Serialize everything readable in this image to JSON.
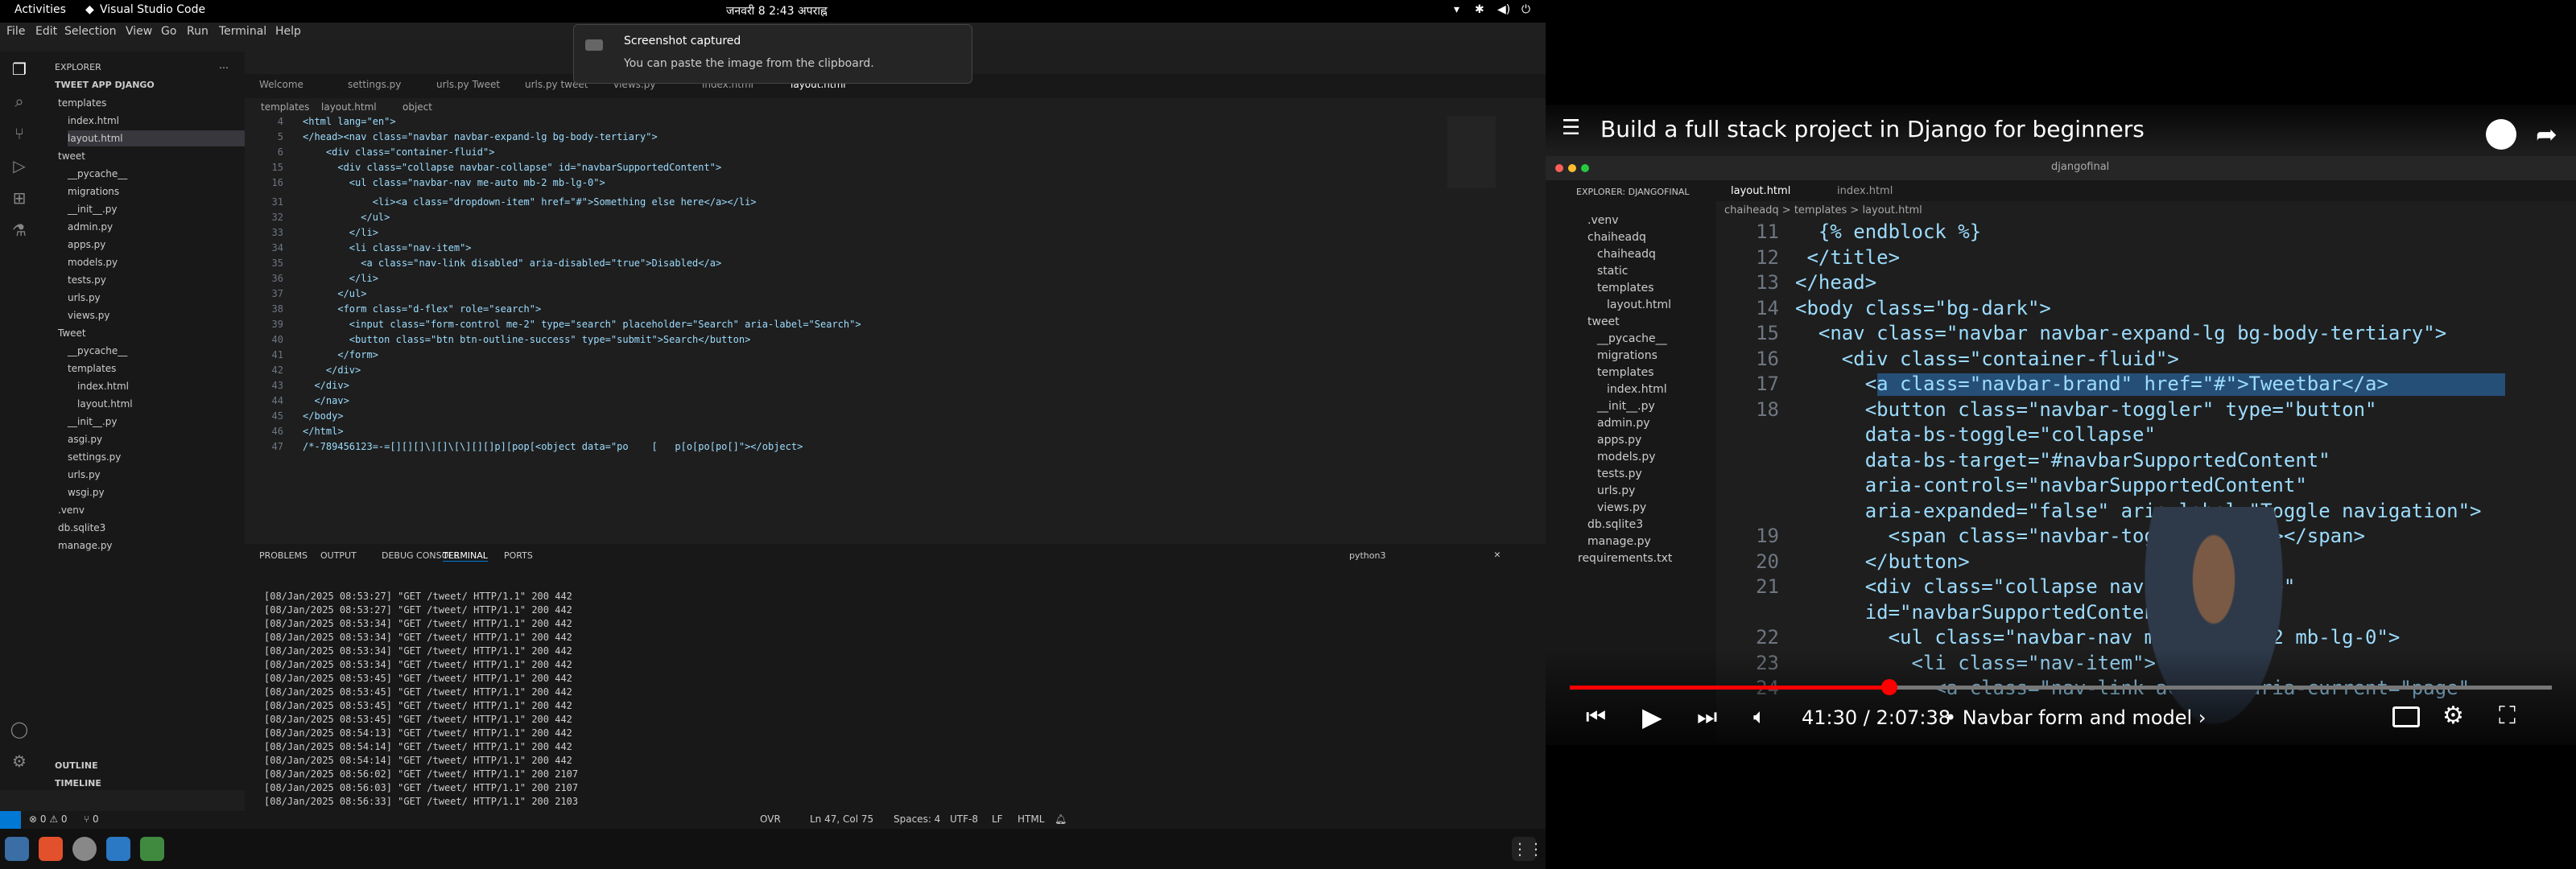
{
  "topbar": {
    "activities": "Activities",
    "app": "Visual Studio Code",
    "datetime": "जनवरी 8  2:43 अपराह्न"
  },
  "menu": [
    "File",
    "Edit",
    "Selection",
    "View",
    "Go",
    "Run",
    "Terminal",
    "Help"
  ],
  "notification": {
    "title": "Screenshot captured",
    "body": "You can paste the image from the clipboard."
  },
  "sidebar": {
    "header": "EXPLORER",
    "project": "TWEET APP DJANGO",
    "items": [
      "templates",
      "index.html",
      "layout.html",
      "tweet",
      "__pycache__",
      "migrations",
      "__init__.py",
      "admin.py",
      "apps.py",
      "models.py",
      "tests.py",
      "urls.py",
      "views.py",
      "Tweet",
      "__pycache__",
      "templates",
      "index.html",
      "layout.html",
      "__init__.py",
      "asgi.py",
      "settings.py",
      "urls.py",
      "wsgi.py",
      ".venv",
      "db.sqlite3",
      "manage.py"
    ],
    "outline": "OUTLINE",
    "timeline": "TIMELINE"
  },
  "tabs": [
    "Welcome",
    "settings.py",
    "urls.py Tweet",
    "urls.py tweet",
    "views.py",
    "index.html",
    "layout.html"
  ],
  "breadcrumb": [
    "templates",
    "layout.html",
    "object"
  ],
  "editor": {
    "sticky": [
      {
        "n": "4",
        "t": "<html lang=\"en\">"
      },
      {
        "n": "5",
        "t": "</head><nav class=\"navbar navbar-expand-lg bg-body-tertiary\">"
      },
      {
        "n": "6",
        "t": "    <div class=\"container-fluid\">"
      },
      {
        "n": "15",
        "t": "      <div class=\"collapse navbar-collapse\" id=\"navbarSupportedContent\">"
      },
      {
        "n": "16",
        "t": "        <ul class=\"navbar-nav me-auto mb-2 mb-lg-0\">"
      }
    ],
    "lines": [
      {
        "n": "31",
        "t": "            <li><a class=\"dropdown-item\" href=\"#\">Something else here</a></li>"
      },
      {
        "n": "32",
        "t": "          </ul>"
      },
      {
        "n": "33",
        "t": "        </li>"
      },
      {
        "n": "34",
        "t": "        <li class=\"nav-item\">"
      },
      {
        "n": "35",
        "t": "          <a class=\"nav-link disabled\" aria-disabled=\"true\">Disabled</a>"
      },
      {
        "n": "36",
        "t": "        </li>"
      },
      {
        "n": "37",
        "t": "      </ul>"
      },
      {
        "n": "38",
        "t": "      <form class=\"d-flex\" role=\"search\">"
      },
      {
        "n": "39",
        "t": "        <input class=\"form-control me-2\" type=\"search\" placeholder=\"Search\" aria-label=\"Search\">"
      },
      {
        "n": "40",
        "t": "        <button class=\"btn btn-outline-success\" type=\"submit\">Search</button>"
      },
      {
        "n": "41",
        "t": "      </form>"
      },
      {
        "n": "42",
        "t": "    </div>"
      },
      {
        "n": "43",
        "t": "  </div>"
      },
      {
        "n": "44",
        "t": "  </nav>"
      },
      {
        "n": "45",
        "t": "</body>"
      },
      {
        "n": "46",
        "t": "</html>"
      },
      {
        "n": "47",
        "t": "/*-789456123=-=[][][]\\][]\\[\\][][]p][pop[<object data=\"po    [   p[o[po[po[]\"></object>"
      }
    ]
  },
  "panel": {
    "tabs": [
      "PROBLEMS",
      "OUTPUT",
      "DEBUG CONSOLE",
      "TERMINAL",
      "PORTS"
    ],
    "shell": "python3",
    "lines": [
      "[08/Jan/2025 08:53:27] \"GET /tweet/ HTTP/1.1\" 200 442",
      "[08/Jan/2025 08:53:27] \"GET /tweet/ HTTP/1.1\" 200 442",
      "[08/Jan/2025 08:53:34] \"GET /tweet/ HTTP/1.1\" 200 442",
      "[08/Jan/2025 08:53:34] \"GET /tweet/ HTTP/1.1\" 200 442",
      "[08/Jan/2025 08:53:34] \"GET /tweet/ HTTP/1.1\" 200 442",
      "[08/Jan/2025 08:53:34] \"GET /tweet/ HTTP/1.1\" 200 442",
      "[08/Jan/2025 08:53:45] \"GET /tweet/ HTTP/1.1\" 200 442",
      "[08/Jan/2025 08:53:45] \"GET /tweet/ HTTP/1.1\" 200 442",
      "[08/Jan/2025 08:53:45] \"GET /tweet/ HTTP/1.1\" 200 442",
      "[08/Jan/2025 08:53:45] \"GET /tweet/ HTTP/1.1\" 200 442",
      "[08/Jan/2025 08:54:13] \"GET /tweet/ HTTP/1.1\" 200 442",
      "[08/Jan/2025 08:54:14] \"GET /tweet/ HTTP/1.1\" 200 442",
      "[08/Jan/2025 08:54:14] \"GET /tweet/ HTTP/1.1\" 200 442",
      "[08/Jan/2025 08:56:02] \"GET /tweet/ HTTP/1.1\" 200 2107",
      "[08/Jan/2025 08:56:03] \"GET /tweet/ HTTP/1.1\" 200 2107",
      "[08/Jan/2025 08:56:33] \"GET /tweet/ HTTP/1.1\" 200 2103"
    ]
  },
  "status": {
    "errors": "⊗ 0 ⚠ 0",
    "ports": "⑂ 0",
    "ovr": "OVR",
    "pos": "Ln 47, Col 75",
    "spaces": "Spaces: 4",
    "enc": "UTF-8",
    "eol": "LF",
    "lang": "HTML"
  },
  "video": {
    "title": "Build a full stack project in Django for beginners",
    "time": "41:30 / 2:07:38",
    "chapter": "• Navbar form and model ›",
    "progress": 0.325,
    "project": "djangofinal",
    "explorer_title": "EXPLORER: DJANGOFINAL",
    "tabs": [
      "layout.html",
      "index.html"
    ],
    "breadcrumb": "chaiheadq > templates > layout.html",
    "tree": [
      ".venv",
      "chaiheadq",
      "chaiheadq",
      "static",
      "templates",
      "layout.html",
      "tweet",
      "__pycache__",
      "migrations",
      "templates",
      "index.html",
      "__init__.py",
      "admin.py",
      "apps.py",
      "models.py",
      "tests.py",
      "urls.py",
      "views.py",
      "db.sqlite3",
      "manage.py",
      "requirements.txt"
    ],
    "code": [
      {
        "n": "11",
        "t": "  {% endblock %}"
      },
      {
        "n": "12",
        "t": " </title>"
      },
      {
        "n": "13",
        "t": "</head>"
      },
      {
        "n": "14",
        "t": "<body class=\"bg-dark\">"
      },
      {
        "n": "15",
        "t": "  <nav class=\"navbar navbar-expand-lg bg-body-tertiary\">"
      },
      {
        "n": "16",
        "t": "    <div class=\"container-fluid\">"
      },
      {
        "n": "17",
        "t": "      <a class=\"navbar-brand\" href=\"#\">Tweetbar</a>"
      },
      {
        "n": "18",
        "t": "      <button class=\"navbar-toggler\" type=\"button\""
      },
      {
        "n": "",
        "t": "      data-bs-toggle=\"collapse\""
      },
      {
        "n": "",
        "t": "      data-bs-target=\"#navbarSupportedContent\""
      },
      {
        "n": "",
        "t": "      aria-controls=\"navbarSupportedContent\""
      },
      {
        "n": "",
        "t": "      aria-expanded=\"false\" aria-label=\"Toggle navigation\">"
      },
      {
        "n": "19",
        "t": "        <span class=\"navbar-toggler-icon\"></span>"
      },
      {
        "n": "20",
        "t": "      </button>"
      },
      {
        "n": "21",
        "t": "      <div class=\"collapse navbar-collapse\""
      },
      {
        "n": "",
        "t": "      id=\"navbarSupportedContent\">"
      },
      {
        "n": "22",
        "t": "        <ul class=\"navbar-nav me-auto mb-2 mb-lg-0\">"
      },
      {
        "n": "23",
        "t": "          <li class=\"nav-item\">"
      },
      {
        "n": "24",
        "t": "            <a class=\"nav-link active\" aria-current=\"page\""
      }
    ]
  },
  "colors": {
    "accent": "#0078d4",
    "progress": "#ff0000",
    "bg": "#1e1e1e"
  }
}
